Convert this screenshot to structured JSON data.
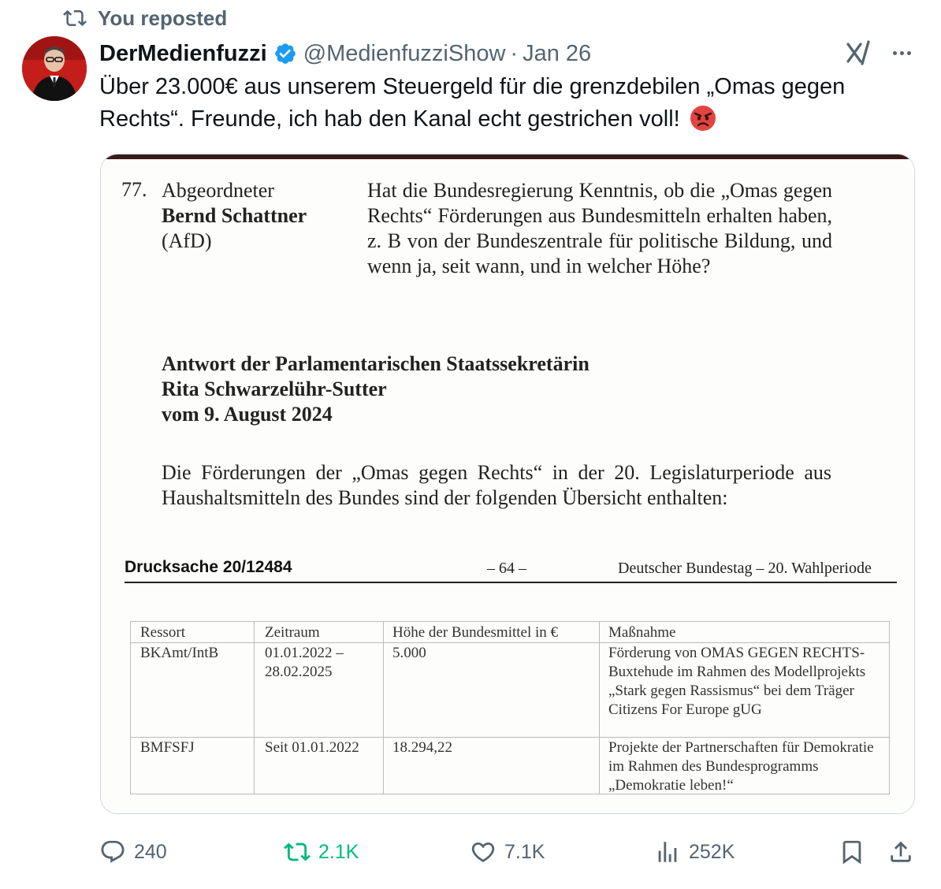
{
  "repost_banner": {
    "text": "You reposted"
  },
  "author": {
    "name": "DerMedienfuzzi",
    "handle": "@MedienfuzziShow",
    "separator": "·",
    "date": "Jan 26"
  },
  "tweet": {
    "text": "Über 23.000€ aus unserem Steuergeld für die grenzdebilen „Omas gegen Rechts“. Freunde, ich hab den Kanal echt gestrichen voll!",
    "emoji": "angry-face-icon"
  },
  "document": {
    "question_number": "77.",
    "member_role": "Abgeordneter",
    "member_name": "Bernd Schattner",
    "member_party": "(AfD)",
    "question": "Hat die Bundesregierung Kenntnis, ob die „Omas gegen Rechts“ Förderungen aus Bundesmitteln erhalten haben, z. B von der Bundeszentrale für politische Bildung, und wenn ja, seit wann, und in welcher Höhe?",
    "answer_line1": "Antwort der Parlamentarischen Staatssekretärin",
    "answer_line2": "Rita Schwarzelühr-Sutter",
    "answer_line3": "vom 9. August 2024",
    "answer_body": "Die Förderungen der „Omas gegen Rechts“ in der 20. Legislaturperiode aus Haushaltsmitteln des Bundes sind der folgenden Übersicht enthalten:",
    "footer_left": "Drucksache 20/12484",
    "footer_mid": "– 64 –",
    "footer_right": "Deutscher Bundestag – 20. Wahlperiode",
    "table": {
      "headers": [
        "Ressort",
        "Zeitraum",
        "Höhe der Bundesmittel in €",
        "Maßnahme"
      ],
      "rows": [
        [
          "BKAmt/IntB",
          "01.01.2022 – 28.02.2025",
          "5.000",
          "Förderung von OMAS GEGEN RECHTS-Buxtehude im Rahmen des Modellprojekts „Stark gegen Rassismus“ bei dem Träger Citizens For Europe gUG"
        ],
        [
          "BMFSFJ",
          "Seit 01.01.2022",
          "18.294,22",
          "Projekte der Partnerschaften für Demokratie im Rahmen des Bundesprogramms „Demokratie leben!“"
        ]
      ]
    }
  },
  "actions": {
    "replies": "240",
    "reposts": "2.1K",
    "likes": "7.1K",
    "views": "252K"
  },
  "colors": {
    "text": "#0f1419",
    "secondary": "#536471",
    "verified": "#1d9bf0",
    "repost_active": "#00ba7c"
  }
}
